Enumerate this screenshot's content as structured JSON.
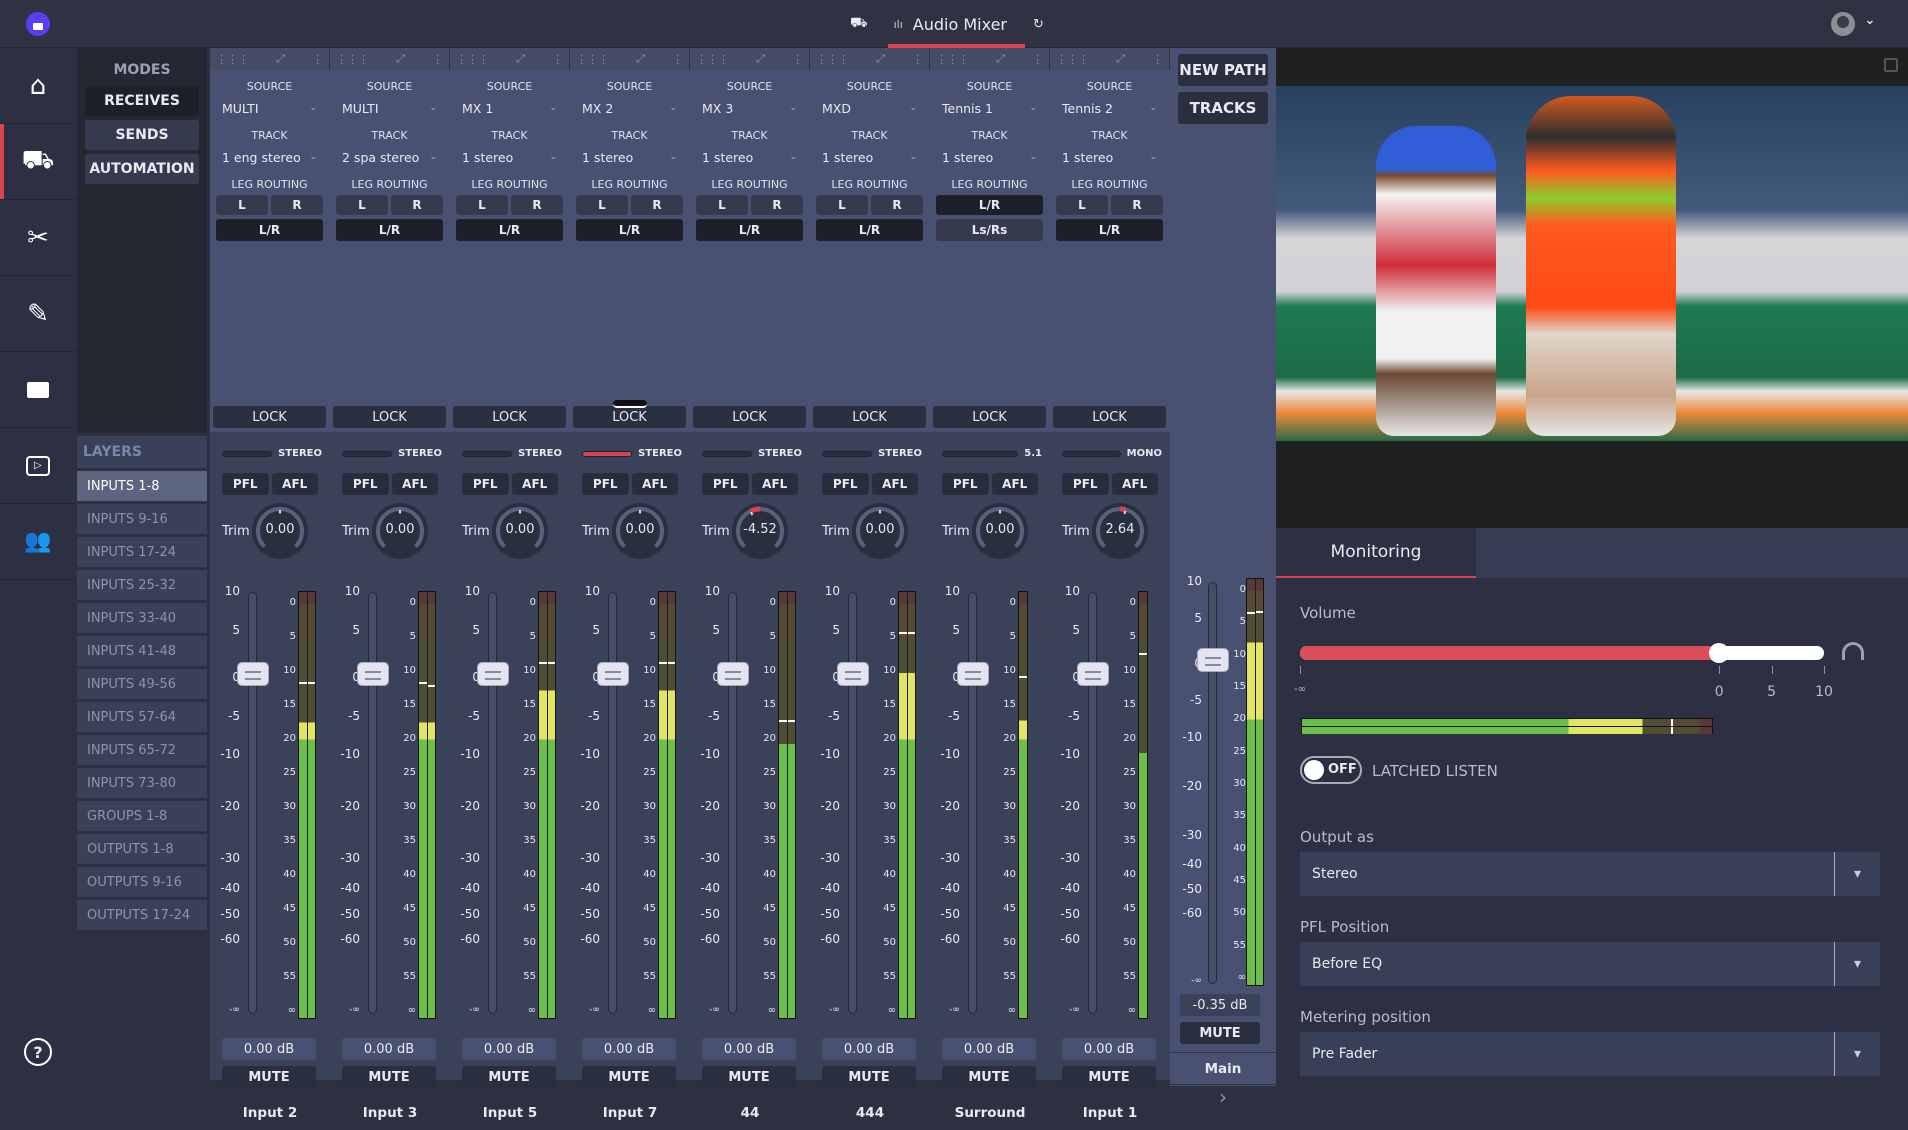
{
  "topbar": {
    "app_icon": "app-logo-icon",
    "director_icon": "director-chair-icon",
    "tab_icon": "audio-waveform-icon",
    "tab_title": "Audio Mixer",
    "refresh_icon": "refresh-icon",
    "user_icon": "user-avatar-icon",
    "user_menu_icon": "chevron-down-icon"
  },
  "rail": {
    "items": [
      {
        "icon": "home-icon",
        "glyph": "⌂"
      },
      {
        "icon": "director-chair-icon",
        "glyph": "⛺",
        "active": true
      },
      {
        "icon": "scissors-icon",
        "glyph": "✂"
      },
      {
        "icon": "edit-script-icon",
        "glyph": "✎"
      },
      {
        "icon": "folder-icon",
        "glyph": "▬"
      },
      {
        "icon": "media-settings-icon",
        "glyph": "▶"
      },
      {
        "icon": "team-icon",
        "glyph": "☻"
      }
    ],
    "help_label": "?"
  },
  "modes": {
    "title": "MODES",
    "items": [
      "RECEIVES",
      "SENDS",
      "AUTOMATION"
    ],
    "selected": "RECEIVES"
  },
  "layers": {
    "title": "LAYERS",
    "items": [
      "INPUTS 1-8",
      "INPUTS 9-16",
      "INPUTS 17-24",
      "INPUTS 25-32",
      "INPUTS 33-40",
      "INPUTS 41-48",
      "INPUTS 49-56",
      "INPUTS 57-64",
      "INPUTS 65-72",
      "INPUTS 73-80",
      "GROUPS 1-8",
      "OUTPUTS 1-8",
      "OUTPUTS 9-16",
      "OUTPUTS 17-24"
    ],
    "selected": "INPUTS 1-8"
  },
  "strip_labels": {
    "source": "SOURCE",
    "track": "TRACK",
    "leg_routing": "LEG ROUTING",
    "lock": "LOCK",
    "pfl": "PFL",
    "afl": "AFL",
    "trim": "Trim",
    "mute": "MUTE",
    "fader_scale": [
      "10",
      "5",
      "0",
      "-5",
      "-10",
      "-20",
      "-30",
      "-40",
      "-50",
      "-60",
      "-∞"
    ],
    "meter_scale": [
      "0",
      "5",
      "10",
      "15",
      "20",
      "25",
      "30",
      "35",
      "40",
      "45",
      "50",
      "55",
      "∞"
    ]
  },
  "channels": [
    {
      "name": "Input 2",
      "source": "MULTI",
      "track": "1 eng stereo",
      "routing": [
        "L",
        "R"
      ],
      "routing_main": "L/R",
      "format": "STEREO",
      "trim": "0.00",
      "trim_value": 0,
      "fader_db": "0.00 dB",
      "meter": [
        17.5,
        17.5
      ],
      "peak": [
        11.5,
        11.5
      ],
      "active_format": false
    },
    {
      "name": "Input 3",
      "source": "MULTI",
      "track": "2 spa stereo",
      "routing": [
        "L",
        "R"
      ],
      "routing_main": "L/R",
      "format": "STEREO",
      "trim": "0.00",
      "trim_value": 0,
      "fader_db": "0.00 dB",
      "meter": [
        17.5,
        17.5
      ],
      "peak": [
        11.5,
        12
      ],
      "active_format": false
    },
    {
      "name": "Input 5",
      "source": "MX 1",
      "track": "1 stereo",
      "routing": [
        "L",
        "R"
      ],
      "routing_main": "L/R",
      "format": "STEREO",
      "trim": "0.00",
      "trim_value": 0,
      "fader_db": "0.00 dB",
      "meter": [
        12.8,
        12.8
      ],
      "peak": [
        8.5,
        8.5
      ],
      "active_format": false
    },
    {
      "name": "Input 7",
      "source": "MX 2",
      "track": "1 stereo",
      "routing": [
        "L",
        "R"
      ],
      "routing_main": "L/R",
      "format": "STEREO",
      "trim": "0.00",
      "trim_value": 0,
      "fader_db": "0.00 dB",
      "meter": [
        12.8,
        12.8
      ],
      "peak": [
        8.5,
        8.5
      ],
      "active_format": true
    },
    {
      "name": "44",
      "source": "MX 3",
      "track": "1 stereo",
      "routing": [
        "L",
        "R"
      ],
      "routing_main": "L/R",
      "format": "STEREO",
      "trim": "-4.52",
      "trim_value": -4.52,
      "fader_db": "0.00 dB",
      "meter": [
        20.7,
        20.7
      ],
      "peak": [
        17.2,
        17.2
      ],
      "active_format": false
    },
    {
      "name": "444",
      "source": "MXD",
      "track": "1 stereo",
      "routing": [
        "L",
        "R"
      ],
      "routing_main": "L/R",
      "format": "STEREO",
      "trim": "0.00",
      "trim_value": 0,
      "fader_db": "0.00 dB",
      "meter": [
        10.2,
        10.2
      ],
      "peak": [
        4.2,
        4.2
      ],
      "active_format": false
    },
    {
      "name": "Surround",
      "source": "Tennis 1",
      "track": "1 stereo",
      "routing": [
        "L/R"
      ],
      "routing_main": "Ls/Rs",
      "format": "5.1",
      "trim": "0.00",
      "trim_value": 0,
      "fader_db": "0.00 dB",
      "meter": [
        17.2
      ],
      "peak": [
        10.7
      ],
      "active_format": false
    },
    {
      "name": "Input 1",
      "source": "Tennis 2",
      "track": "1 stereo",
      "routing": [
        "L",
        "R"
      ],
      "routing_main": "L/R",
      "format": "MONO",
      "trim": "2.64",
      "trim_value": 2.64,
      "fader_db": "0.00 dB",
      "meter": [
        22
      ],
      "peak": [
        7.2
      ],
      "active_format": false
    }
  ],
  "main_strip": {
    "new_path": "NEW PATH",
    "tracks": "TRACKS",
    "fader_db": "-0.35 dB",
    "mute": "MUTE",
    "name": "Main",
    "next_icon": "chevron-right-icon",
    "meter": [
      8,
      8
    ],
    "peak": [
      3.3,
      3.1
    ],
    "fader_scale": [
      "10",
      "5",
      "0",
      "-5",
      "-10",
      "-20",
      "-30",
      "-40",
      "-50",
      "-60",
      "-∞"
    ],
    "meter_scale": [
      "0",
      "5",
      "10",
      "15",
      "20",
      "25",
      "30",
      "35",
      "40",
      "45",
      "50",
      "55",
      "∞"
    ]
  },
  "preview": {
    "popout_icon": "popout-icon",
    "description": "lacrosse game video preview"
  },
  "monitoring": {
    "tab": "Monitoring",
    "volume_label": "Volume",
    "volume_ticks": [
      "-∞",
      "0",
      "5",
      "10"
    ],
    "volume_db": 0,
    "volume_range": [
      -60,
      10
    ],
    "headphones_icon": "headphones-icon",
    "latched_toggle": "OFF",
    "latched_label": "LATCHED LISTEN",
    "output_label": "Output as",
    "output_value": "Stereo",
    "pfl_label": "PFL Position",
    "pfl_value": "Before EQ",
    "metering_label": "Metering position",
    "metering_value": "Pre Fader"
  },
  "colors": {
    "accent": "#d9434f",
    "meter_green": "#6cc04a",
    "meter_yellow": "#e2e464",
    "meter_dim_green": "#4d4e34",
    "meter_dim_brown": "#574a35",
    "meter_dim_red": "#5a3838"
  }
}
